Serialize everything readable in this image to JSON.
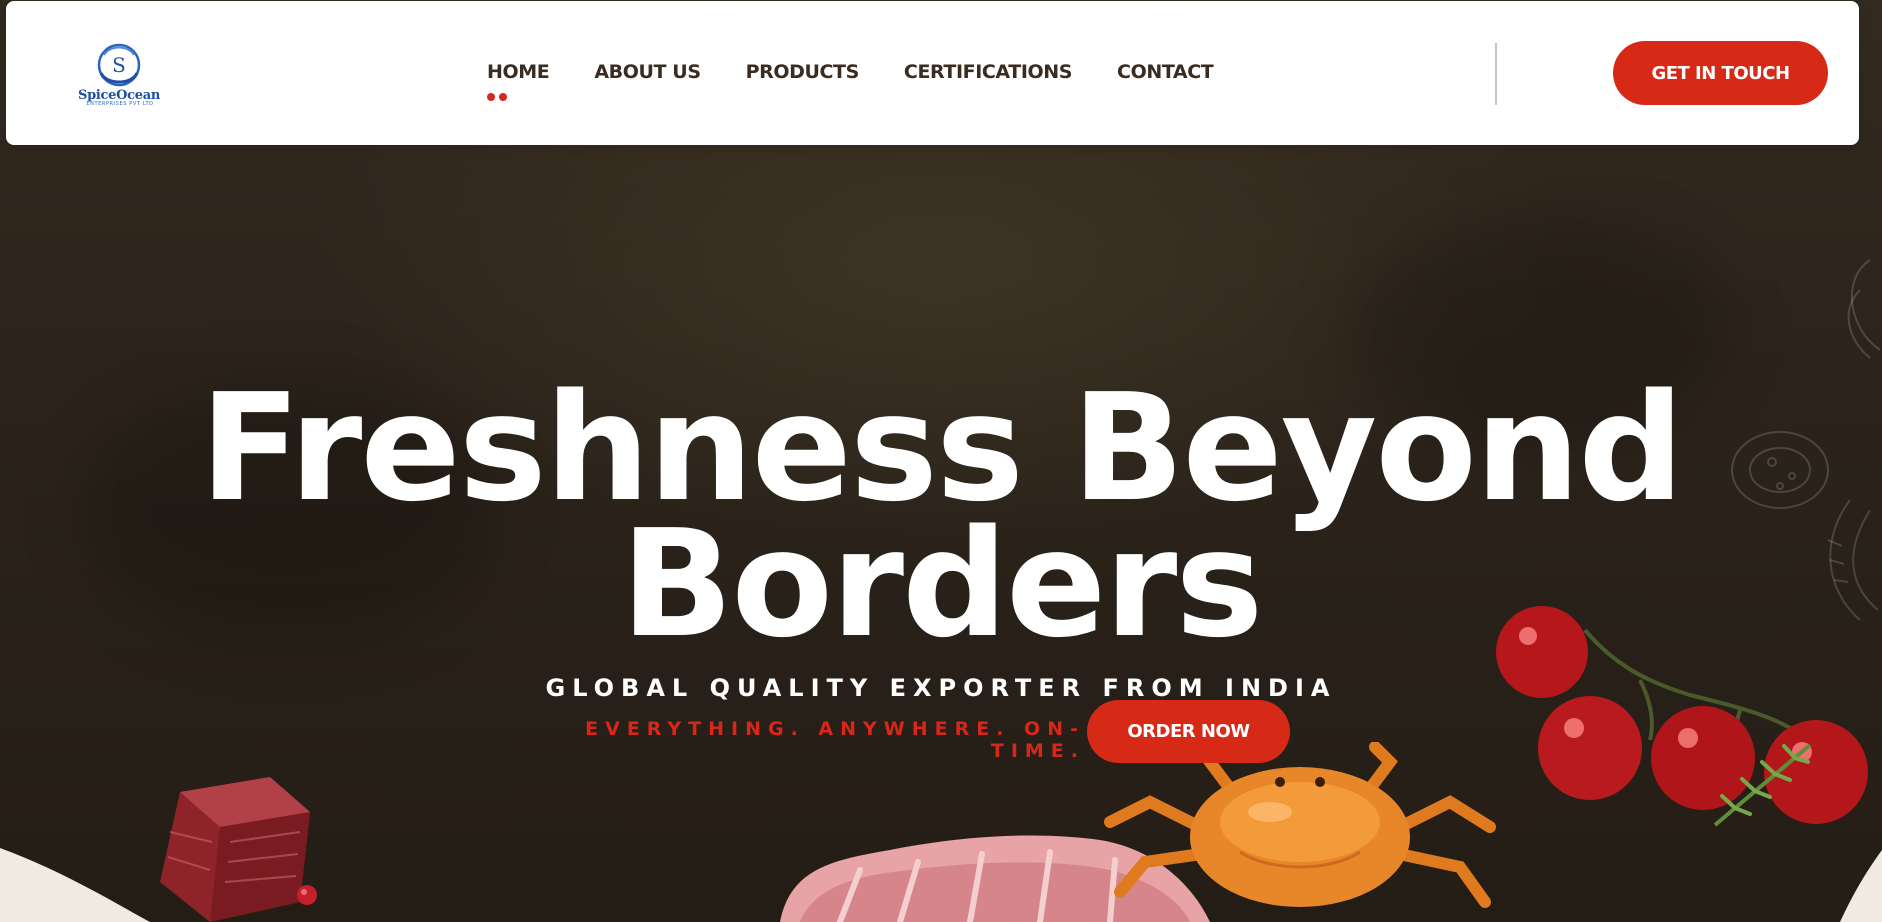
{
  "brand": {
    "name": "SpiceOcean",
    "tagline": "ENTERPRISES PVT LTD",
    "logo_letter": "S",
    "colors": {
      "primary": "#d62a17",
      "dark": "#2c241b",
      "nav_text": "#3a2c20",
      "logo_blue": "#1e4fa3"
    }
  },
  "nav": {
    "items": [
      {
        "label": "HOME",
        "active": true
      },
      {
        "label": "ABOUT US",
        "active": false
      },
      {
        "label": "PRODUCTS",
        "active": false
      },
      {
        "label": "CERTIFICATIONS",
        "active": false
      },
      {
        "label": "CONTACT",
        "active": false
      }
    ],
    "cta_label": "GET IN TOUCH"
  },
  "hero": {
    "title_line1": "Freshness Beyond",
    "title_line2": "Borders",
    "subtitle": "GLOBAL QUALITY EXPORTER FROM INDIA",
    "tagline": "EVERYTHING. ANYWHERE. ON-TIME.",
    "order_label": "ORDER NOW"
  },
  "images": {
    "meat_cube": "meat-cube-image",
    "ribs": "pork-ribs-image",
    "crab": "crab-image",
    "tomatoes": "cherry-tomatoes-image",
    "rosemary": "rosemary-sprig-image",
    "peppercorn": "pink-peppercorn-image"
  }
}
